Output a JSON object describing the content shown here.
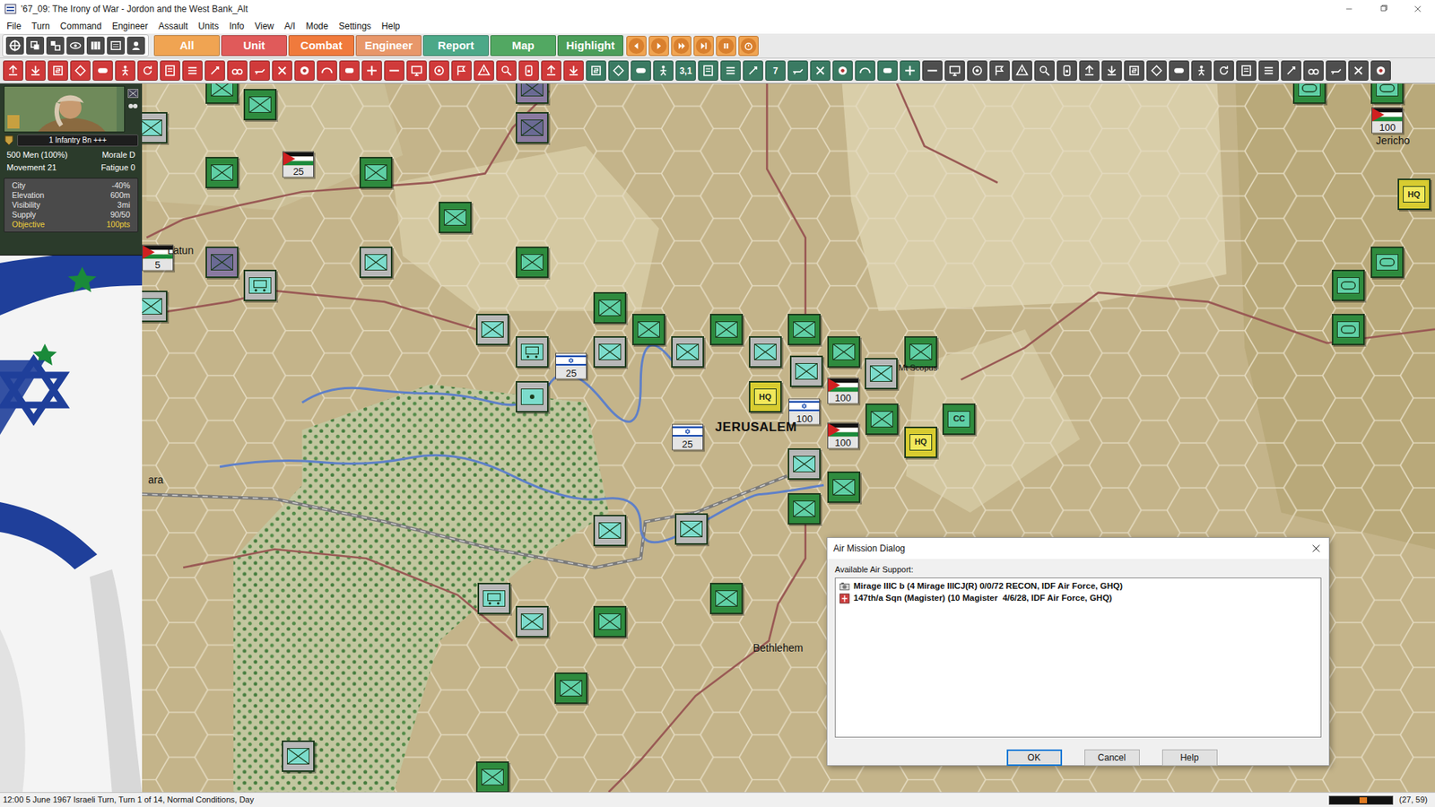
{
  "window": {
    "title": "'67_09: The Irony of War - Jordon and the West Bank_Alt"
  },
  "menu": [
    "File",
    "Turn",
    "Command",
    "Engineer",
    "Assault",
    "Units",
    "Info",
    "View",
    "A/I",
    "Mode",
    "Settings",
    "Help"
  ],
  "tabs": [
    {
      "label": "All",
      "color": "#f0a452"
    },
    {
      "label": "Unit",
      "color": "#e05a5a"
    },
    {
      "label": "Combat",
      "color": "#f07a3c"
    },
    {
      "label": "Engineer",
      "color": "#e8976a"
    },
    {
      "label": "Report",
      "color": "#4ca888"
    },
    {
      "label": "Map",
      "color": "#52a862"
    },
    {
      "label": "Highlight",
      "color": "#4c9e5a"
    }
  ],
  "toolbar_texts": [
    "3,1",
    "7"
  ],
  "unit_panel": {
    "name": "1 Infantry Bn +++",
    "men": "500 Men (100%)",
    "morale": "Morale D",
    "movement": "Movement 21",
    "fatigue": "Fatigue 0",
    "terrain": [
      {
        "label": "City",
        "value": "-40%",
        "highlight": false
      },
      {
        "label": "Elevation",
        "value": "600m",
        "highlight": false
      },
      {
        "label": "Visibility",
        "value": "3mi",
        "highlight": false
      },
      {
        "label": "Supply",
        "value": "90/50",
        "highlight": false
      },
      {
        "label": "Objective",
        "value": "100pts",
        "highlight": true
      }
    ]
  },
  "map": {
    "labels": [
      {
        "text": "Latun",
        "kind": "town"
      },
      {
        "text": "JERUSALEM",
        "kind": "city"
      },
      {
        "text": "Mt Scopus",
        "kind": "small"
      },
      {
        "text": "Bethlehem",
        "kind": "town"
      },
      {
        "text": "Jericho",
        "kind": "town"
      },
      {
        "text": "ara",
        "kind": "town"
      }
    ],
    "objectives": [
      {
        "value": "25",
        "side": "jordan"
      },
      {
        "value": "5",
        "side": "jordan"
      },
      {
        "value": "25",
        "side": "israel"
      },
      {
        "value": "25",
        "side": "israel"
      },
      {
        "value": "100",
        "side": "jordan"
      },
      {
        "value": "100",
        "side": "israel"
      },
      {
        "value": "100",
        "side": "jordan"
      },
      {
        "value": "100",
        "side": "jordan"
      }
    ],
    "units": [
      {
        "kind": "infantry",
        "color": "#2e8b3e"
      },
      {
        "kind": "infantry",
        "color": "#2e8b3e"
      },
      {
        "kind": "infantry",
        "color": "#b8b8b8"
      },
      {
        "kind": "infantry",
        "color": "#8a7aa0"
      },
      {
        "kind": "infantry",
        "color": "#8a7aa0"
      },
      {
        "kind": "infantry",
        "color": "#2e8b3e"
      },
      {
        "kind": "infantry",
        "color": "#2e8b3e"
      },
      {
        "kind": "infantry",
        "color": "#2e8b3e"
      },
      {
        "kind": "infantry",
        "color": "#2e8b3e"
      },
      {
        "kind": "infantry",
        "color": "#b8b8b8"
      },
      {
        "kind": "infantry",
        "color": "#8a7aa0"
      },
      {
        "kind": "mech",
        "color": "#b8b8b8"
      },
      {
        "kind": "infantry",
        "color": "#b8b8b8"
      },
      {
        "kind": "infantry",
        "color": "#2e8b3e"
      },
      {
        "kind": "infantry",
        "color": "#2e8b3e"
      },
      {
        "kind": "infantry",
        "color": "#2e8b3e"
      },
      {
        "kind": "infantry",
        "color": "#2e8b3e"
      },
      {
        "kind": "infantry",
        "color": "#b8b8b8"
      },
      {
        "kind": "mech",
        "color": "#b8b8b8"
      },
      {
        "kind": "infantry",
        "color": "#b8b8b8"
      },
      {
        "kind": "infantry",
        "color": "#b8b8b8"
      },
      {
        "kind": "infantry",
        "color": "#b8b8b8"
      },
      {
        "kind": "infantry",
        "color": "#2e8b3e"
      },
      {
        "kind": "infantry",
        "color": "#2e8b3e"
      },
      {
        "kind": "infantry",
        "color": "#b8b8b8"
      },
      {
        "kind": "infantry",
        "color": "#b8b8b8"
      },
      {
        "kind": "artillery",
        "color": "#b8b8b8"
      },
      {
        "kind": "hq",
        "color": "#d8cc30",
        "label": "HQ"
      },
      {
        "kind": "infantry",
        "color": "#2e8b3e"
      },
      {
        "kind": "cc",
        "color": "#2e8b3e",
        "label": "CC"
      },
      {
        "kind": "hq",
        "color": "#d8cc30",
        "label": "HQ"
      },
      {
        "kind": "infantry",
        "color": "#b8b8b8"
      },
      {
        "kind": "infantry",
        "color": "#2e8b3e"
      },
      {
        "kind": "infantry",
        "color": "#2e8b3e"
      },
      {
        "kind": "infantry",
        "color": "#b8b8b8"
      },
      {
        "kind": "infantry",
        "color": "#b8b8b8"
      },
      {
        "kind": "mech",
        "color": "#b8b8b8"
      },
      {
        "kind": "infantry",
        "color": "#b8b8b8"
      },
      {
        "kind": "infantry",
        "color": "#2e8b3e"
      },
      {
        "kind": "infantry",
        "color": "#2e8b3e"
      },
      {
        "kind": "infantry",
        "color": "#2e8b3e"
      },
      {
        "kind": "infantry",
        "color": "#b8b8b8"
      },
      {
        "kind": "infantry",
        "color": "#2e8b3e"
      },
      {
        "kind": "armor",
        "color": "#2e8b3e"
      },
      {
        "kind": "armor",
        "color": "#2e8b3e"
      },
      {
        "kind": "hq",
        "color": "#d8cc30",
        "label": "HQ"
      },
      {
        "kind": "armor",
        "color": "#2e8b3e"
      },
      {
        "kind": "armor",
        "color": "#2e8b3e"
      },
      {
        "kind": "armor",
        "color": "#2e8b3e"
      }
    ]
  },
  "dialog": {
    "title": "Air Mission Dialog",
    "label": "Available Air Support:",
    "items": [
      {
        "text": "Mirage IIIC b (4 Mirage IIICJ(R) 0/0/72 RECON, IDF Air Force, GHQ)",
        "kind": "recon",
        "selected": false
      },
      {
        "text": "147th/a Sqn (Magister) (10 Magister  4/6/28, IDF Air Force, GHQ)",
        "kind": "strike",
        "selected": false
      }
    ],
    "buttons": [
      {
        "label": "OK",
        "default": true
      },
      {
        "label": "Cancel",
        "default": false
      },
      {
        "label": "Help",
        "default": false
      }
    ]
  },
  "status_bar": {
    "text": "12:00 5 June 1967 Israeli Turn, Turn 1 of 14, Normal Conditions, Day",
    "coords": "(27, 59)"
  }
}
